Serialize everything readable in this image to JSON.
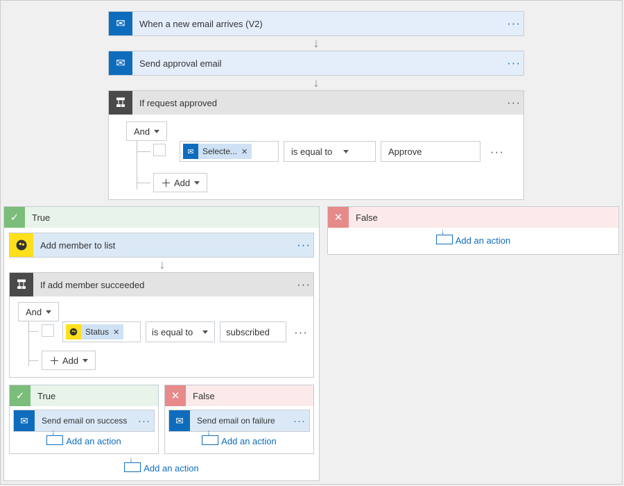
{
  "trigger": {
    "title": "When a new email arrives (V2)"
  },
  "approval": {
    "title": "Send approval email"
  },
  "cond1": {
    "title": "If request approved",
    "logic": "And",
    "row": {
      "tag": "Selecte...",
      "op": "is equal to",
      "val": "Approve"
    },
    "add": "Add"
  },
  "trueBranch": {
    "label": "True",
    "addMember": {
      "title": "Add member to list"
    },
    "cond2": {
      "title": "If add member succeeded",
      "logic": "And",
      "row": {
        "tag": "Status",
        "op": "is equal to",
        "val": "subscribed"
      },
      "add": "Add"
    },
    "innerTrue": {
      "label": "True",
      "action": "Send email on success",
      "addAction": "Add an action"
    },
    "innerFalse": {
      "label": "False",
      "action": "Send email on failure",
      "addAction": "Add an action"
    },
    "addAction": "Add an action"
  },
  "falseBranch": {
    "label": "False",
    "addAction": "Add an action"
  }
}
